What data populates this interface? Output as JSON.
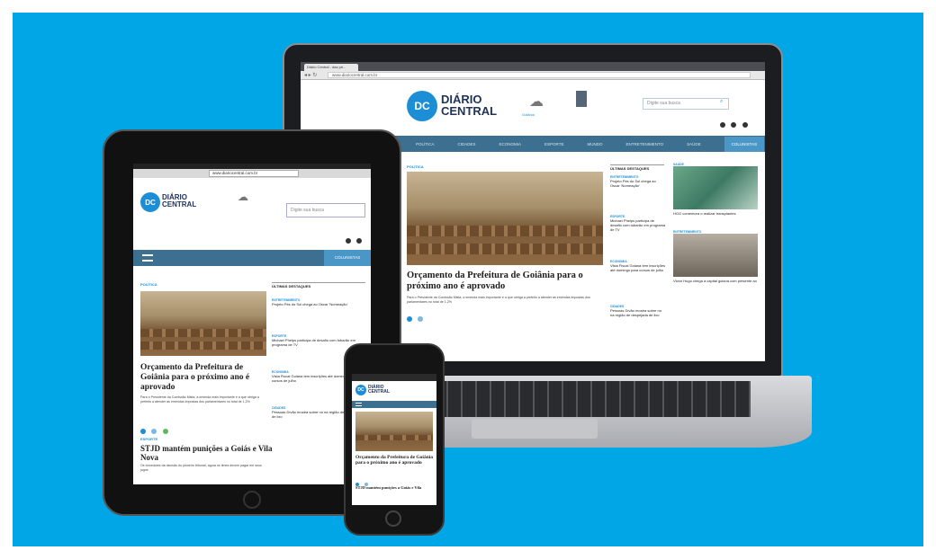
{
  "brand": {
    "line1": "DIÁRIO",
    "line2": "CENTRAL",
    "initials": "DC"
  },
  "laptop": {
    "tab_title": "Diário Central - das pri...",
    "url": "www.diariocentral.com.br",
    "search_placeholder": "Digite sua busca",
    "weather_text": "Goiânia",
    "nav": [
      "POLÍTICA",
      "CIDADES",
      "ECONOMIA",
      "ESPORTE",
      "MUNDO",
      "ENTRETENIMENTO",
      "SAÚDE",
      "COLUNISTAS"
    ],
    "main_cat": "POLÍTICA",
    "headline": "Orçamento da Prefeitura de Goiânia para o próximo ano é aprovado",
    "summary": "Para o Presidente da Comissão Mista, a emenda mais importante é a que obriga a prefeito a atender as emendas impostas dos parlamentares no total de 1,2%",
    "side_title": "ÚLTIMAS DESTAQUES",
    "side_items": [
      {
        "cat": "ENTRETENIMENTO",
        "text": "Projeto Pés do Sol chega ao Oscar 'Nomeação'"
      },
      {
        "cat": "ESPORTE",
        "text": "Michael Phelps participa de desafio com tubarão em programa de TV"
      },
      {
        "cat": "ECONOMIA",
        "text": "Vista Fiscal Goiana tem inscrições até domingo para cursos de julho"
      },
      {
        "cat": "CIDADES",
        "text": "Pessoas Dívão mostra sobre no na região de despejada de lixo"
      }
    ],
    "right_col": [
      {
        "cat": "SAÚDE",
        "text": "HGG comemora o realizar transplantes"
      },
      {
        "cat": "ENTRETENIMENTO",
        "text": "Victor Hugo chega à capital goiana com presente ao "
      }
    ]
  },
  "tablet": {
    "url": "www.diariocentral.com.br",
    "search_placeholder": "Digite sua busca",
    "nav_right": "COLUNISTAS",
    "main_cat": "POLÍTICA",
    "headline": "Orçamento da Prefeitura de Goiânia para o próximo ano é aprovado",
    "summary": "Para o Presidente da Comissão Mista, a emenda mais importante é a que obriga a prefeito a atender as emendas impostas dos parlamentares no total de 1,2%",
    "side_title": "ÚLTIMAS DESTAQUES",
    "side_items": [
      {
        "cat": "ENTRETENIMENTO",
        "text": "Projeto Pés do Sol chega ao Oscar 'Nomeação'"
      },
      {
        "cat": "ESPORTE",
        "text": "Michael Phelps participa de desafio com tubarão em programa de TV"
      },
      {
        "cat": "ECONOMIA",
        "text": "Vista Fiscal Goiana tem inscrições até domingo para cursos de julho"
      },
      {
        "cat": "CIDADES",
        "text": "Pessoas Dívão mostra sobre no na região de despejada de lixo"
      }
    ],
    "second_cat": "ESPORTE",
    "second_headline": "STJD mantém punições a Goiás e Vila Nova",
    "second_summary": "Os torcedores da decisão do primeiro tribunal, agora os times devem pagar em seus jogos"
  },
  "phone": {
    "headline": "Orçamento da Prefeitura de Goiânia para o próximo ano é aprovado",
    "second_headline": "STJD mantém punições a Goiás e Vila"
  },
  "colors": {
    "background": "#00a6e6",
    "brand_blue": "#1c8ed6",
    "nav_blue": "#3d6f90"
  }
}
